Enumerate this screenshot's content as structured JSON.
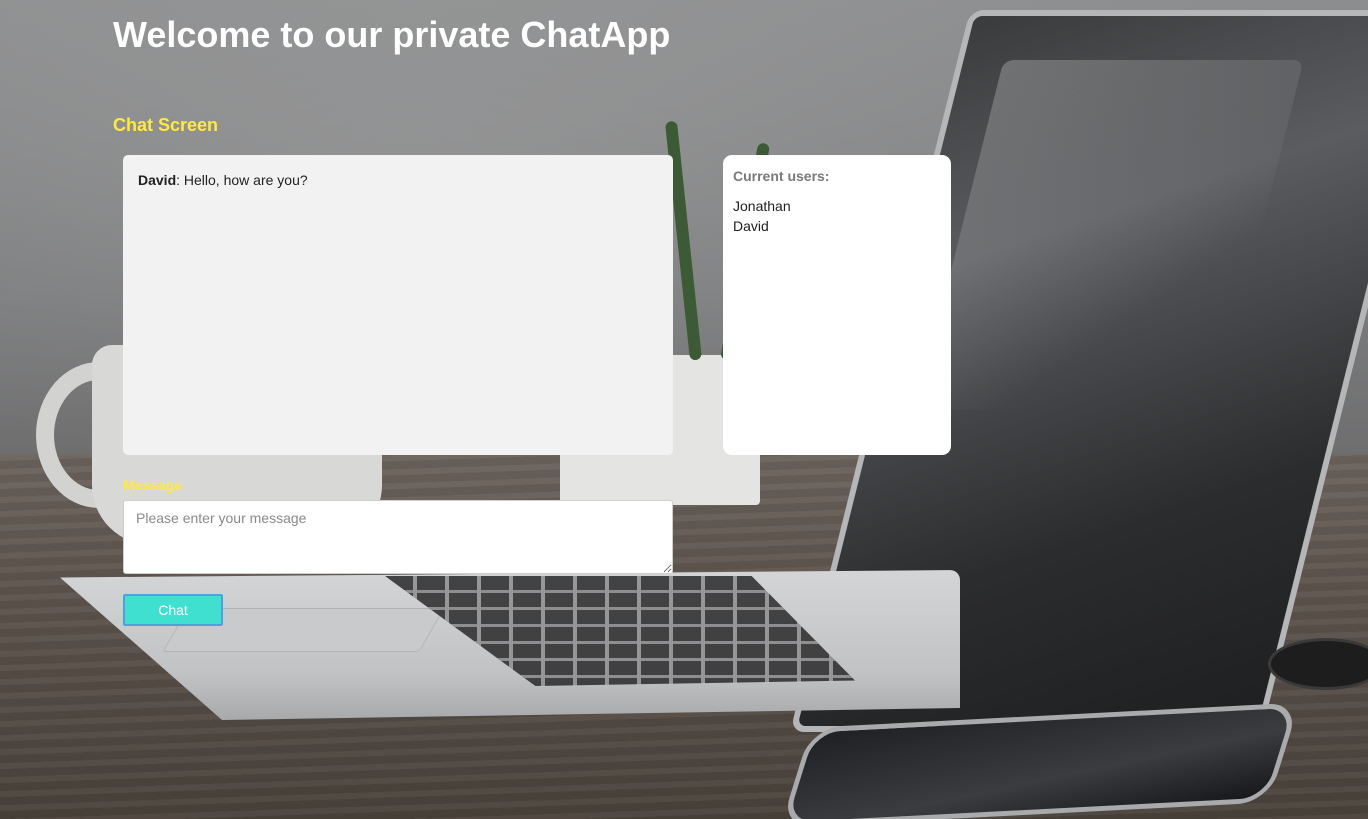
{
  "header": {
    "title": "Welcome to our private ChatApp"
  },
  "chat": {
    "section_title": "Chat Screen",
    "messages": [
      {
        "author": "David",
        "separator": ":",
        "text": " Hello, how are you?"
      }
    ]
  },
  "users_panel": {
    "title": "Current users:",
    "users": [
      "Jonathan",
      "David"
    ]
  },
  "composer": {
    "label": "Message",
    "placeholder": "Please enter your message",
    "value": "",
    "button_label": "Chat"
  },
  "colors": {
    "accent_yellow": "#ffeb3b",
    "button_teal": "#40e0d0",
    "button_border": "#4aa3df",
    "chat_box_bg": "#f2f2f2"
  }
}
